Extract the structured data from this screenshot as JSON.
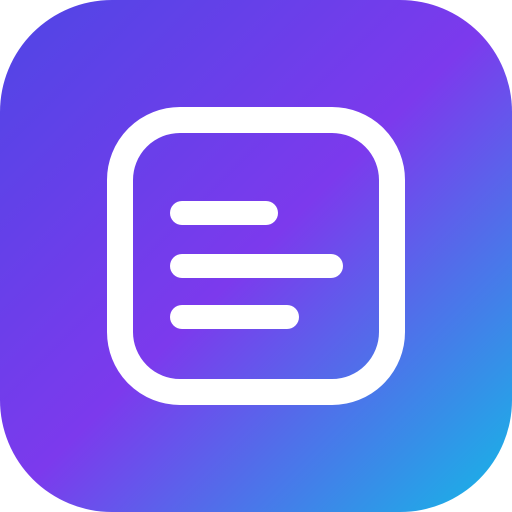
{
  "icon": {
    "name": "notes-list-app-icon",
    "glyph": "document-lines-icon",
    "colors": {
      "gradient_start": "#4F46E5",
      "gradient_mid": "#7C3AED",
      "gradient_end": "#14B8E6",
      "glyph": "#FFFFFF"
    }
  }
}
